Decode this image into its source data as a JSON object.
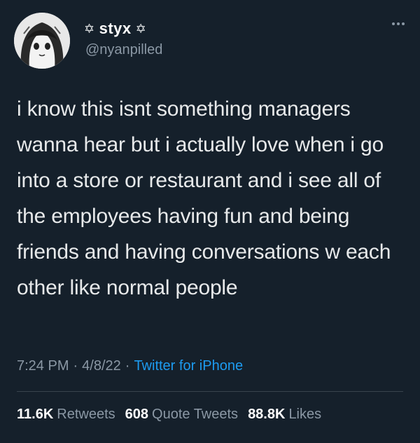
{
  "user": {
    "display_name": "styx",
    "name_decoration_left": "✡",
    "name_decoration_right": "✡",
    "handle": "@nyanpilled",
    "avatar_icon": "anime-girl-avatar"
  },
  "tweet": {
    "text": "i know this isnt something managers wanna hear but i actually love when i go into a store or restaurant and i see all of the employees having fun and being friends and having conversations w each other like normal people"
  },
  "meta": {
    "time": "7:24 PM",
    "sep1": "·",
    "date": "4/8/22",
    "sep2": "·",
    "source": "Twitter for iPhone"
  },
  "stats": {
    "retweets_count": "11.6K",
    "retweets_label": "Retweets",
    "quotes_count": "608",
    "quotes_label": "Quote Tweets",
    "likes_count": "88.8K",
    "likes_label": "Likes"
  },
  "colors": {
    "background": "#15202b",
    "text": "#e7e9ea",
    "secondary": "#8b98a5",
    "link": "#1d9bf0"
  }
}
